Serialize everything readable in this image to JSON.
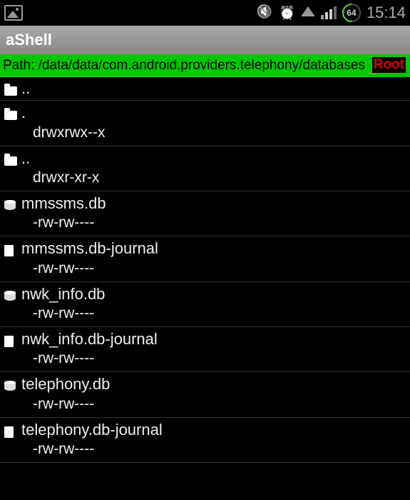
{
  "status_bar": {
    "battery_percent": "64",
    "time": "15:14"
  },
  "app": {
    "title": "aShell"
  },
  "path_bar": {
    "prefix": "Path: ",
    "path": "/data/data/com.android.providers.telephony/databases",
    "root_label": "Root"
  },
  "files": [
    {
      "icon": "folder",
      "name": "..",
      "perms": null
    },
    {
      "icon": "folder",
      "name": ".",
      "perms": "drwxrwx--x"
    },
    {
      "icon": "folder",
      "name": "..",
      "perms": "drwxr-xr-x"
    },
    {
      "icon": "db",
      "name": "mmssms.db",
      "perms": "-rw-rw----"
    },
    {
      "icon": "doc",
      "name": "mmssms.db-journal",
      "perms": "-rw-rw----"
    },
    {
      "icon": "db",
      "name": "nwk_info.db",
      "perms": "-rw-rw----"
    },
    {
      "icon": "doc",
      "name": "nwk_info.db-journal",
      "perms": "-rw-rw----"
    },
    {
      "icon": "db",
      "name": "telephony.db",
      "perms": "-rw-rw----"
    },
    {
      "icon": "doc",
      "name": "telephony.db-journal",
      "perms": "-rw-rw----"
    }
  ]
}
